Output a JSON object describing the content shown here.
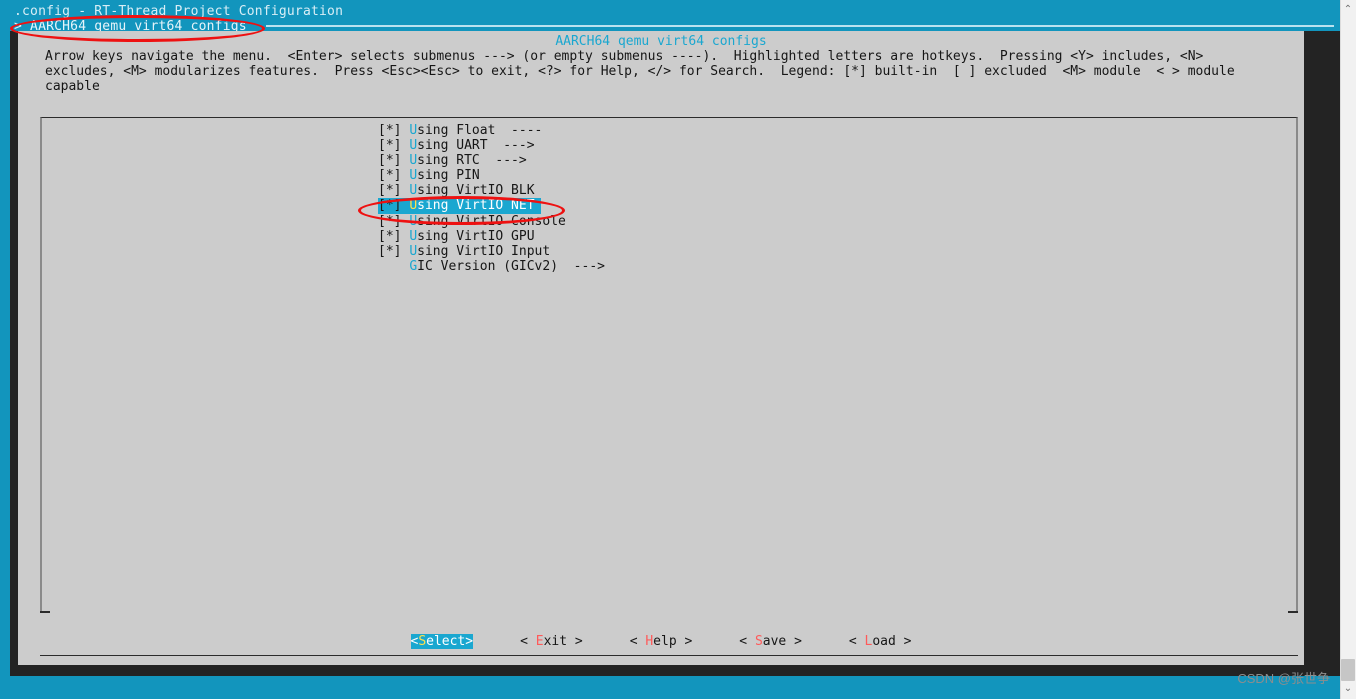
{
  "window": {
    "app_title": ".config - RT-Thread Project Configuration",
    "breadcrumb": "> AARCH64 qemu virt64 configs"
  },
  "dialog": {
    "title": "AARCH64 qemu virt64 configs",
    "prompt": "Arrow keys navigate the menu.  <Enter> selects submenus ---> (or empty submenus ----).  Highlighted letters are hotkeys.  Pressing <Y> includes, <N> excludes, <M> modularizes features.  Press <Esc><Esc> to exit, <?> for Help, </> for Search.  Legend: [*] built-in  [ ] excluded  <M> module  < > module capable"
  },
  "menu": {
    "items": [
      {
        "box": "[*]",
        "hotkey": "U",
        "rest": "sing Float  ----",
        "selected": false
      },
      {
        "box": "[*]",
        "hotkey": "U",
        "rest": "sing UART  --->",
        "selected": false
      },
      {
        "box": "[*]",
        "hotkey": "U",
        "rest": "sing RTC  --->",
        "selected": false
      },
      {
        "box": "[*]",
        "hotkey": "U",
        "rest": "sing PIN",
        "selected": false
      },
      {
        "box": "[*]",
        "hotkey": "U",
        "rest": "sing VirtIO BLK",
        "selected": false
      },
      {
        "box": "[*]",
        "hotkey": "U",
        "rest": "sing VirtIO NET",
        "selected": true
      },
      {
        "box": "[*]",
        "hotkey": "U",
        "rest": "sing VirtIO Console",
        "selected": false
      },
      {
        "box": "[*]",
        "hotkey": "U",
        "rest": "sing VirtIO GPU",
        "selected": false
      },
      {
        "box": "[*]",
        "hotkey": "U",
        "rest": "sing VirtIO Input",
        "selected": false
      },
      {
        "box": "   ",
        "hotkey": "G",
        "rest": "IC Version (GICv2)  --->",
        "selected": false
      }
    ]
  },
  "buttons": [
    {
      "pre": "<",
      "hotkey": "S",
      "post": "elect>",
      "active": true
    },
    {
      "pre": "< ",
      "hotkey": "E",
      "post": "xit >",
      "active": false
    },
    {
      "pre": "< ",
      "hotkey": "H",
      "post": "elp >",
      "active": false
    },
    {
      "pre": "< ",
      "hotkey": "S",
      "post": "ave >",
      "active": false
    },
    {
      "pre": "< ",
      "hotkey": "L",
      "post": "oad >",
      "active": false
    }
  ],
  "annotations": {
    "breadcrumb_highlight": "red-ellipse",
    "selected_row_highlight": "red-ellipse"
  },
  "watermark": {
    "text": "CSDN @张世争"
  },
  "scrollbar": {
    "up_arrow": "⌃",
    "down_arrow": "⌄"
  },
  "colors": {
    "terminal_cyan": "#1295bd",
    "terminal_dark": "#232323",
    "dialog_gray": "#cccccc",
    "accent_cyan": "#1aa7d0",
    "hotkey_yellow": "#ffe14d",
    "hotkey_red": "#ff5a5a",
    "annotation_red": "#ee1111"
  }
}
